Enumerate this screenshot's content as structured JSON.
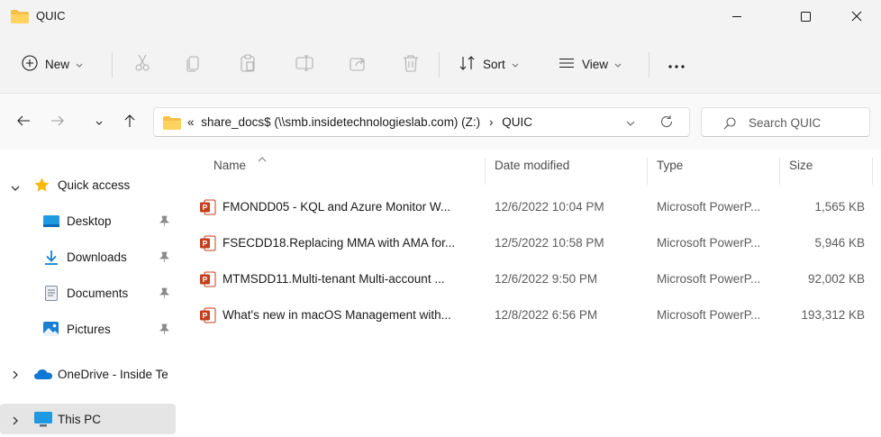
{
  "window": {
    "title": "QUIC",
    "controls": [
      "minimize-icon",
      "maximize-icon",
      "close-icon"
    ]
  },
  "toolbar": {
    "new_label": "New",
    "sort_label": "Sort",
    "view_label": "View",
    "icons": [
      "cut-icon",
      "copy-icon",
      "paste-icon",
      "rename-icon",
      "share-icon",
      "delete-icon",
      "more-icon"
    ]
  },
  "address": {
    "overflow": "«",
    "crumb1": "share_docs$ (\\\\smb.insidetechnologieslab.com) (Z:)",
    "separator": "›",
    "crumb2": "QUIC"
  },
  "search": {
    "placeholder": "Search QUIC"
  },
  "columns": {
    "name": "Name",
    "date": "Date modified",
    "type": "Type",
    "size": "Size"
  },
  "files": [
    {
      "name": "FMONDD05 - KQL and Azure Monitor W...",
      "date": "12/6/2022 10:04 PM",
      "type": "Microsoft PowerP...",
      "size": "1,565 KB"
    },
    {
      "name": "FSECDD18.Replacing MMA with AMA for...",
      "date": "12/5/2022 10:58 PM",
      "type": "Microsoft PowerP...",
      "size": "5,946 KB"
    },
    {
      "name": "MTMSDD11.Multi-tenant Multi-account ...",
      "date": "12/6/2022 9:50 PM",
      "type": "Microsoft PowerP...",
      "size": "92,002 KB"
    },
    {
      "name": "What's new in macOS Management with...",
      "date": "12/8/2022 6:56 PM",
      "type": "Microsoft PowerP...",
      "size": "193,312 KB"
    }
  ],
  "sidebar": {
    "quick_access": "Quick access",
    "desktop": "Desktop",
    "downloads": "Downloads",
    "documents": "Documents",
    "pictures": "Pictures",
    "onedrive": "OneDrive - Inside Te",
    "this_pc": "This PC"
  },
  "colors": {
    "accent": "#0067c0",
    "folder": "#f5c04a",
    "star": "#f7b900",
    "powerpoint": "#c43e1c",
    "selected_bg": "#e5e5e5"
  }
}
